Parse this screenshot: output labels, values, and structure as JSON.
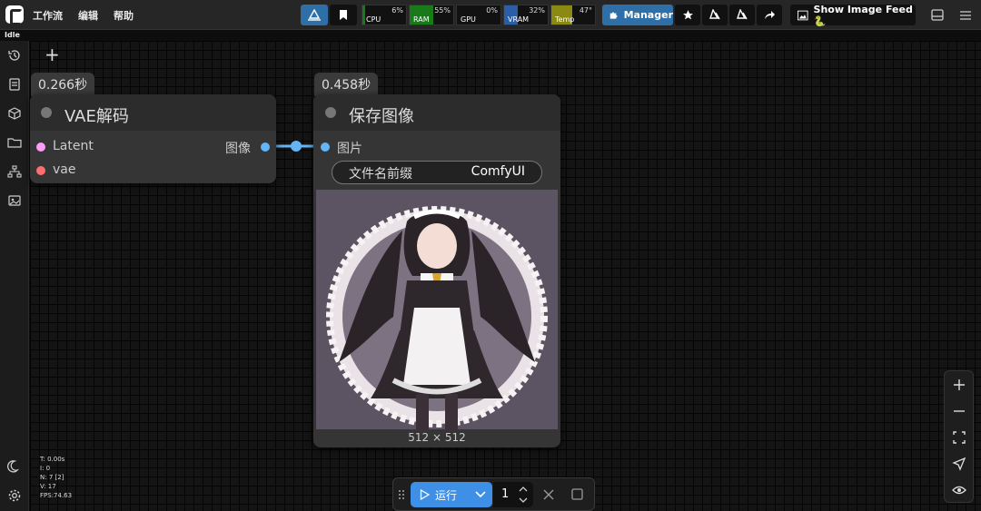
{
  "menu": {
    "workflow": "工作流",
    "edit": "编辑",
    "help": "帮助"
  },
  "status": "Idle",
  "meters": {
    "cpu": {
      "label": "CPU",
      "value": "6%",
      "percent": 6,
      "color": "#1a7a1a"
    },
    "ram": {
      "label": "RAM",
      "value": "55%",
      "percent": 55,
      "color": "#1a7a1a"
    },
    "gpu": {
      "label": "GPU",
      "value": "0%",
      "percent": 0,
      "color": "#1a7a1a"
    },
    "vram": {
      "label": "VRAM",
      "value": "32%",
      "percent": 32,
      "color": "#2a5fa8"
    },
    "temp": {
      "label": "Temp",
      "value": "47°",
      "percent": 47,
      "color": "#8a8a12"
    }
  },
  "toolbar": {
    "manager": "Manager",
    "feed": "Show Image Feed 🐍"
  },
  "nodes": {
    "vae": {
      "time": "0.266秒",
      "title": "VAE解码",
      "inputs": [
        "Latent",
        "vae"
      ],
      "output": "图像"
    },
    "save": {
      "time": "0.458秒",
      "title": "保存图像",
      "input": "图片",
      "widget_label": "文件名前缀",
      "widget_value": "ComfyUI",
      "image_size": "512 × 512"
    }
  },
  "stats": [
    "T: 0.00s",
    "I: 0",
    "N: 7 [2]",
    "V: 17",
    "FPS:74.63"
  ],
  "run": {
    "label": "运行",
    "count": "1"
  },
  "colors": {
    "accent": "#3e8fe6",
    "latent": "#ff9cf9",
    "vae": "#ff6e6e",
    "image": "#64b5f6"
  }
}
